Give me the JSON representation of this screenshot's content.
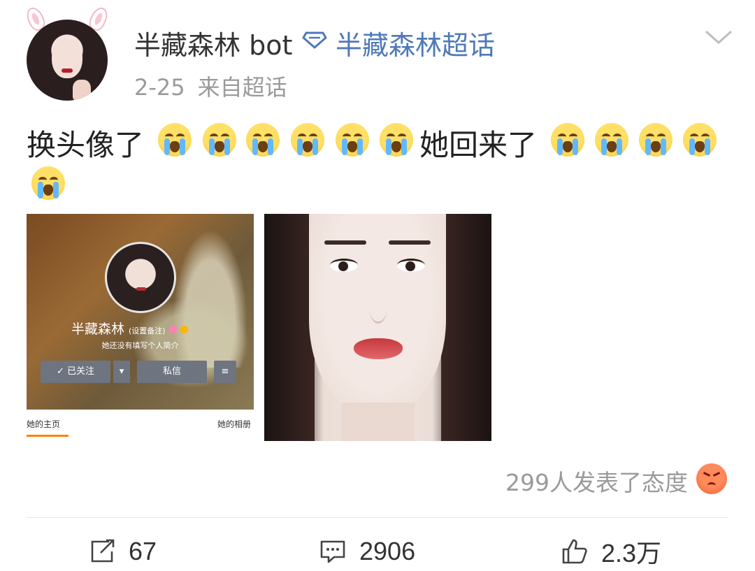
{
  "post": {
    "username": "半藏森林 bot",
    "supertopic": "半藏森林超话",
    "date": "2-25",
    "source": "来自超话",
    "text_parts": [
      "换头像了",
      "她回来了"
    ],
    "embedded_profile": {
      "name": "半藏森林",
      "remark": "(设置备注)",
      "bio": "她还没有填写个人简介",
      "follow_label": "已关注",
      "message_label": "私信",
      "tab_home": "她的主页",
      "tab_album": "她的相册"
    },
    "attitude_text": "299人发表了态度"
  },
  "actions": {
    "repost_count": "67",
    "comment_count": "2906",
    "like_count": "2.3万"
  },
  "icons": {
    "verified": "diamond-icon",
    "menu": "chevron-down-icon",
    "emoji": "crying-emoji",
    "reaction": "angry-emoji",
    "repost": "repost-icon",
    "comment": "comment-icon",
    "like": "thumbs-up-icon"
  },
  "colors": {
    "link": "#4f79b8",
    "muted": "#9a9a9a",
    "accent_tab": "#ff8200"
  }
}
